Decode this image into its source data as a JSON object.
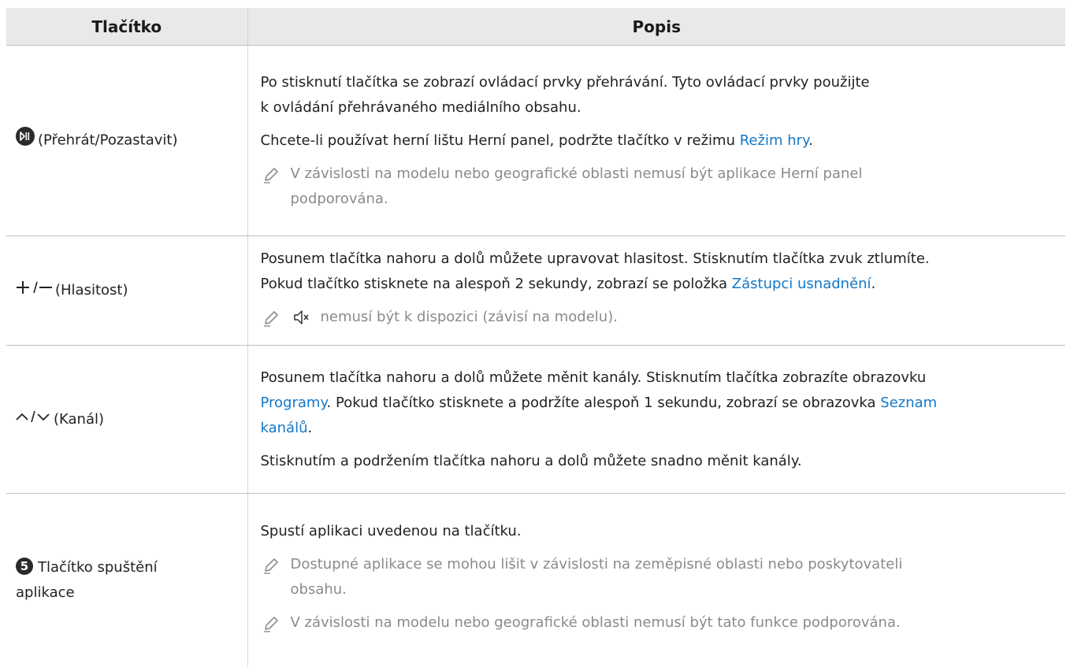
{
  "table": {
    "headers": [
      "Tlačítko",
      "Popis"
    ],
    "rows": [
      {
        "button": "(Přehrát/Pozastavit)",
        "icon": "play-pause-icon",
        "p1": "Po stisknutí tlačítka se zobrazí ovládací prvky přehrávání. Tyto ovládací prvky použijte",
        "p1b": "k ovládání přehrávaného mediálního obsahu.",
        "p2_before": "Chcete-li používat herní lištu Herní panel, podržte tlačítko v režimu ",
        "p2_link": "Režim hry",
        "p2_after": ".",
        "note_1": "V závislosti na modelu nebo geografické oblasti nemusí být aplikace Herní panel",
        "note_2": "podporována."
      },
      {
        "button": "(Hlasitost)",
        "icon": "volume-plus-minus-icon",
        "p1": "Posunem tlačítka nahoru a dolů můžete upravovat hlasitost. Stisknutím tlačítka zvuk ztlumíte.",
        "p2_before": "Pokud tlačítko stisknete na alespoň 2 sekundy, zobrazí se položka ",
        "p2_link": "Zástupci usnadnění",
        "p2_after": ".",
        "note": "nemusí být k dispozici (závisí na modelu)."
      },
      {
        "button": "(Kanál)",
        "icon": "channel-up-down-icon",
        "p1": "Posunem tlačítka nahoru a dolů můžete měnit kanály. Stisknutím tlačítka zobrazíte obrazovku",
        "p2_link1": "Programy",
        "p2_mid": ". Pokud tlačítko stisknete a podržíte alespoň 1 sekundu, zobrazí se obrazovka ",
        "p2_link2": "Seznam",
        "p3_link": "kanálů",
        "p3_after": ".",
        "p4": "Stisknutím a podržením tlačítka nahoru a dolů můžete snadno měnit kanály."
      },
      {
        "badge": "5",
        "button_l1": "Tlačítko spuštění",
        "button_l2": "aplikace",
        "p1": "Spustí aplikaci uvedenou na tlačítku.",
        "note1_l1": "Dostupné aplikace se mohou lišit v závislosti na zeměpisné oblasti nebo poskytovateli",
        "note1_l2": "obsahu.",
        "note2": "V závislosti na modelu nebo geografické oblasti nemusí být tato funkce podporována."
      }
    ]
  }
}
